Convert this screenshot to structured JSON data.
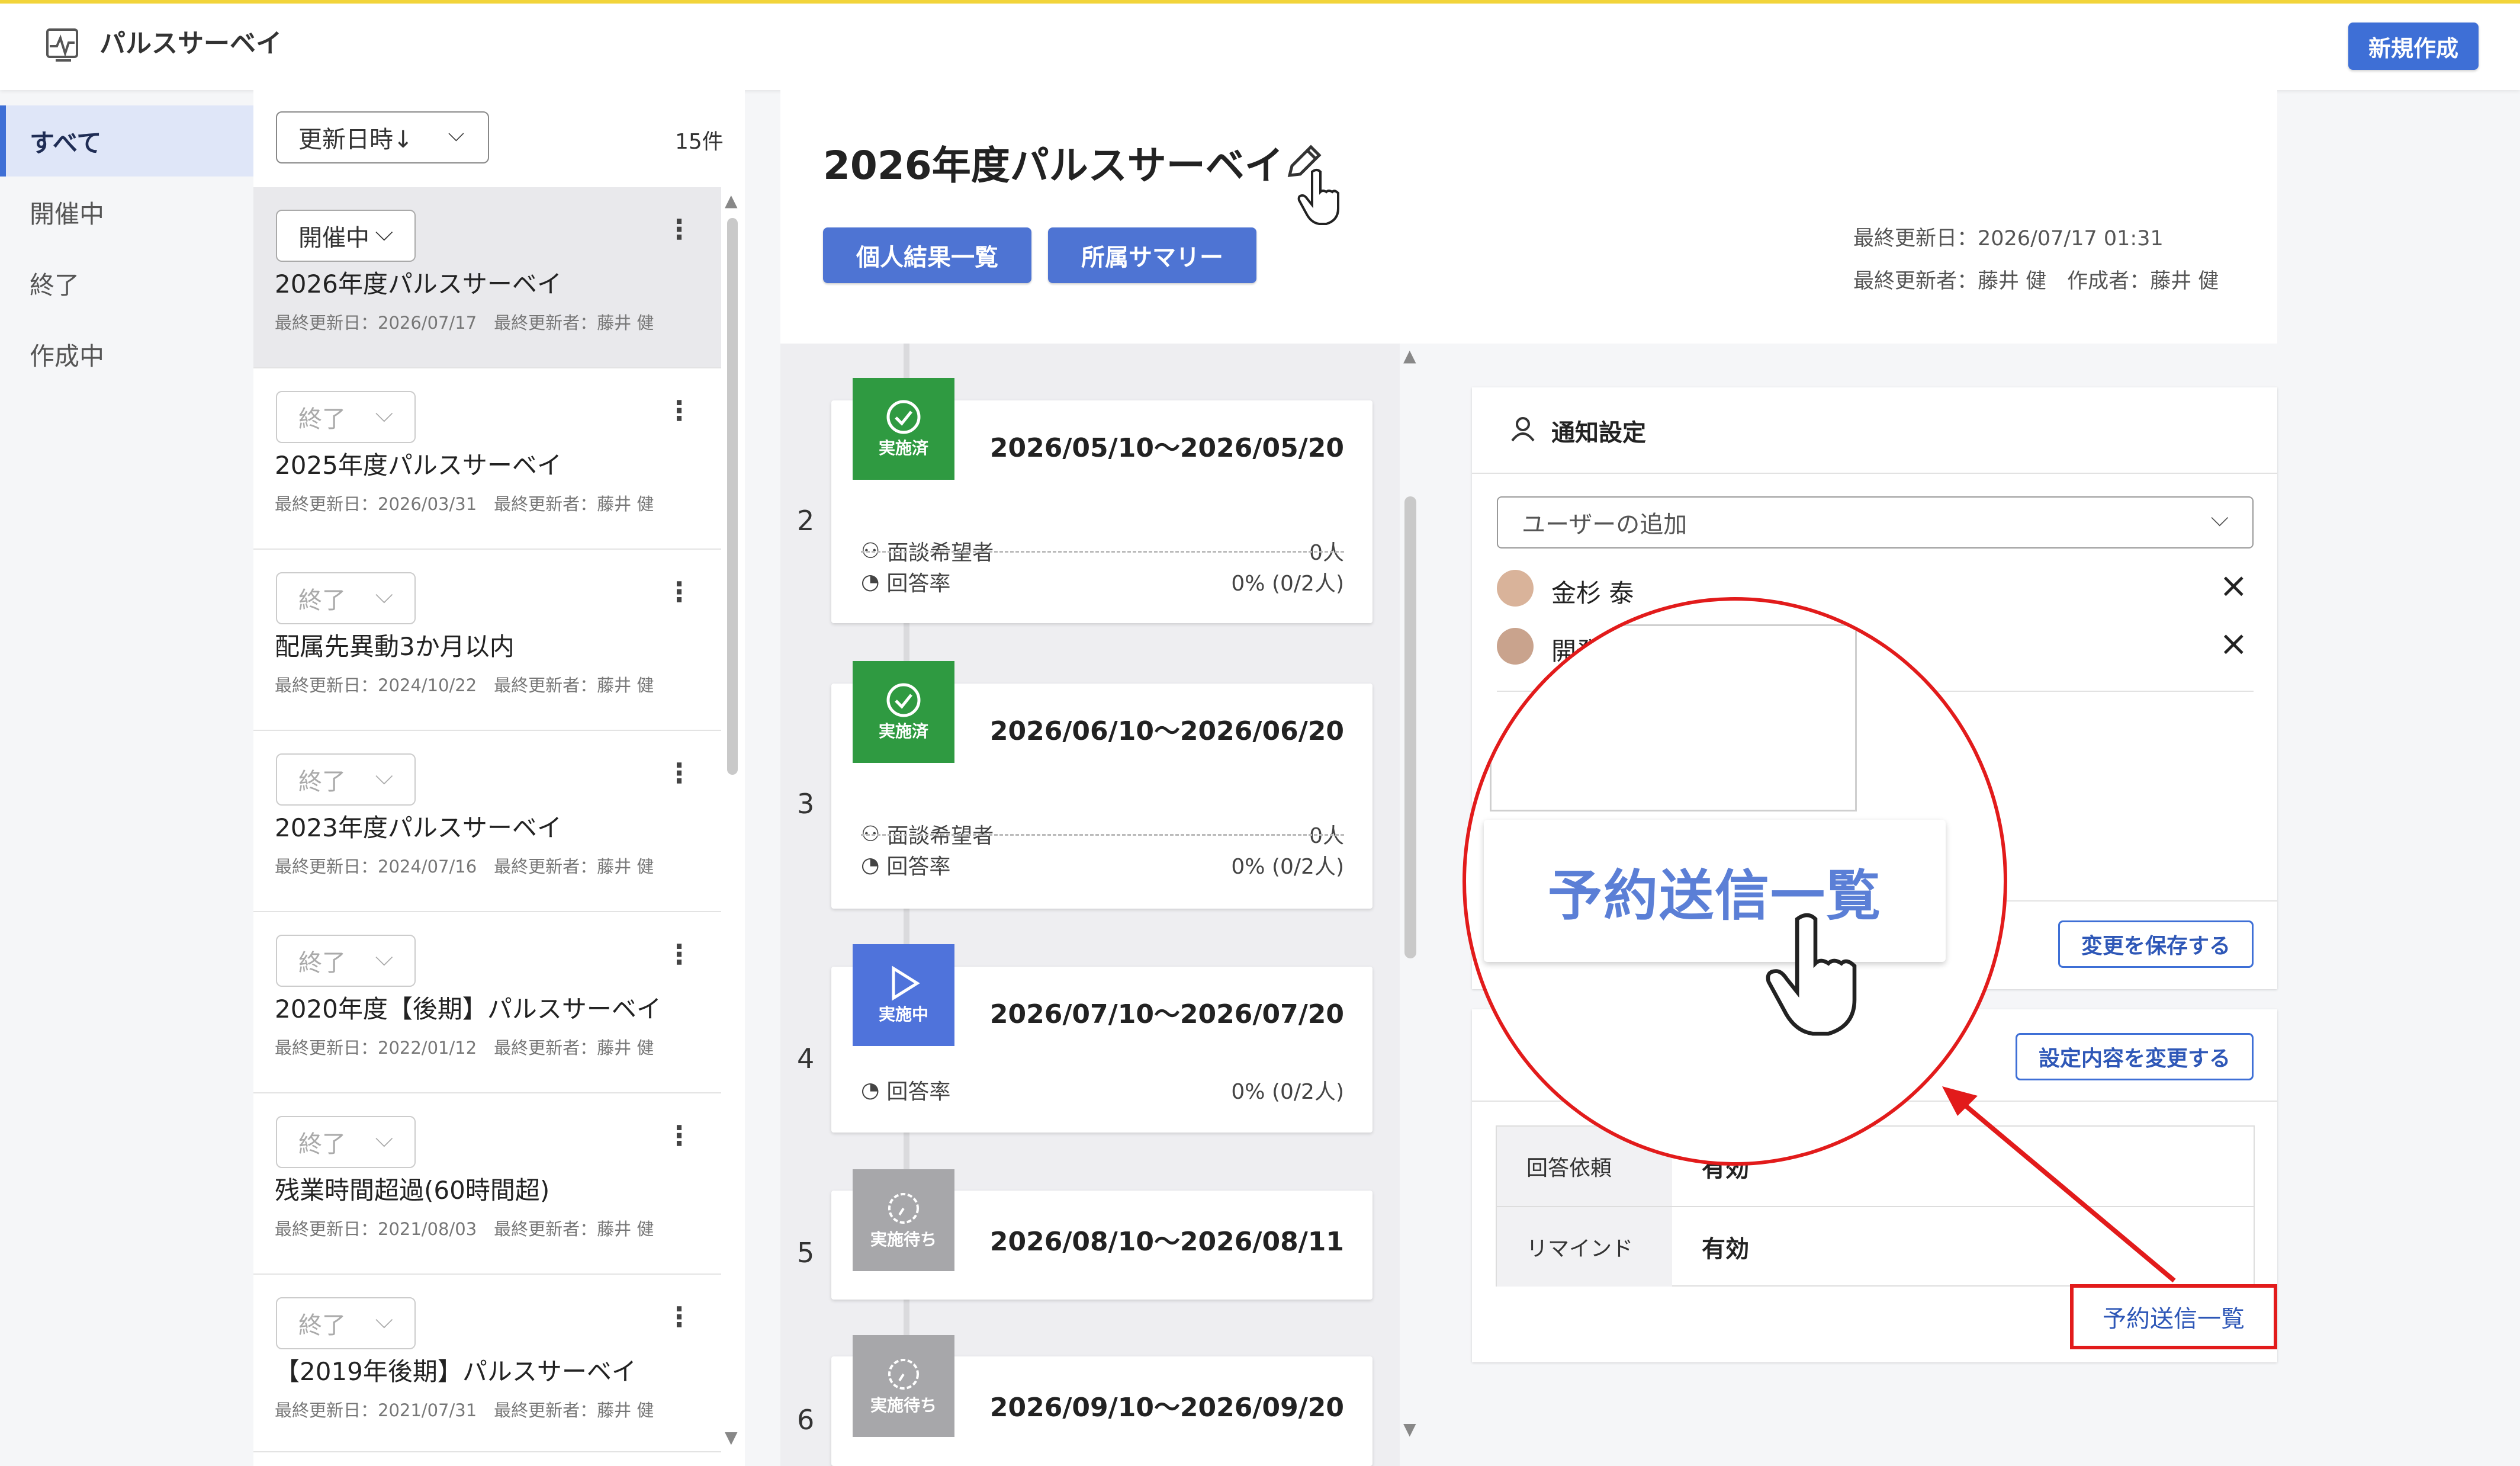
{
  "header": {
    "app_name": "パルスサーベイ",
    "new_button": "新規作成"
  },
  "nav": {
    "items": [
      {
        "label": "すべて",
        "active": true
      },
      {
        "label": "開催中",
        "active": false
      },
      {
        "label": "終了",
        "active": false
      },
      {
        "label": "作成中",
        "active": false
      }
    ]
  },
  "list": {
    "sort_label": "更新日時↓",
    "count": "15件",
    "items": [
      {
        "status": "開催中",
        "title": "2026年度パルスサーベイ",
        "meta": "最終更新日：2026/07/17　最終更新者：藤井 健"
      },
      {
        "status": "終了",
        "title": "2025年度パルスサーベイ",
        "meta": "最終更新日：2026/03/31　最終更新者：藤井 健"
      },
      {
        "status": "終了",
        "title": "配属先異動3か月以内",
        "meta": "最終更新日：2024/10/22　最終更新者：藤井 健"
      },
      {
        "status": "終了",
        "title": "2023年度パルスサーベイ",
        "meta": "最終更新日：2024/07/16　最終更新者：藤井 健"
      },
      {
        "status": "終了",
        "title": "2020年度【後期】パルスサーベイ",
        "meta": "最終更新日：2022/01/12　最終更新者：藤井 健"
      },
      {
        "status": "終了",
        "title": "残業時間超過(60時間超)",
        "meta": "最終更新日：2021/08/03　最終更新者：藤井 健"
      },
      {
        "status": "終了",
        "title": "【2019年後期】パルスサーベイ",
        "meta": "最終更新日：2021/07/31　最終更新者：藤井 健"
      }
    ]
  },
  "detail": {
    "title": "2026年度パルスサーベイ",
    "buttons": {
      "personal": "個人結果一覧",
      "summary": "所属サマリー"
    },
    "updated_at": "最終更新日：2026/07/17 01:31",
    "updated_by": "最終更新者：藤井 健　作成者：藤井 健"
  },
  "phases": [
    {
      "num": "2",
      "status": "実施済",
      "date": "2026/05/10～2026/05/20",
      "interview_label": "面談希望者",
      "interview_value": "0人",
      "rate_label": "回答率",
      "rate_value": "0% (0/2人)"
    },
    {
      "num": "3",
      "status": "実施済",
      "date": "2026/06/10～2026/06/20",
      "interview_label": "面談希望者",
      "interview_value": "0人",
      "rate_label": "回答率",
      "rate_value": "0% (0/2人)"
    },
    {
      "num": "4",
      "status": "実施中",
      "date": "2026/07/10～2026/07/20",
      "rate_label": "回答率",
      "rate_value": "0% (0/2人)"
    },
    {
      "num": "5",
      "status": "実施待ち",
      "date": "2026/08/10～2026/08/11"
    },
    {
      "num": "6",
      "status": "実施待ち",
      "date": "2026/09/10～2026/09/20"
    }
  ],
  "notify": {
    "title": "通知設定",
    "user_placeholder": "ユーザーの追加",
    "users": [
      "金杉 泰",
      "開発"
    ],
    "save_button": "変更を保存する"
  },
  "delivery": {
    "change_button": "設定内容を変更する",
    "rows": [
      {
        "label": "回答依頼",
        "value": "有効"
      },
      {
        "label": "リマインド",
        "value": "有効"
      }
    ],
    "reserve_link": "予約送信一覧"
  },
  "magnifier": {
    "label": "予約送信一覧"
  },
  "colors": {
    "accent": "#3e6fd6",
    "done": "#2f9a41",
    "running": "#4f73db",
    "waiting": "#a7a7aa",
    "highlight": "#e21b1b"
  }
}
